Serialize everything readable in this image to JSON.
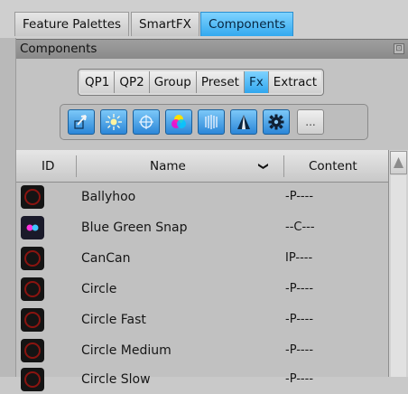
{
  "tabs": [
    {
      "label": "Feature Palettes",
      "active": false
    },
    {
      "label": "SmartFX",
      "active": false
    },
    {
      "label": "Components",
      "active": true
    }
  ],
  "panel": {
    "title": "Components",
    "collapse_glyph": "⊡"
  },
  "segments": [
    {
      "label": "QP1",
      "active": false
    },
    {
      "label": "QP2",
      "active": false
    },
    {
      "label": "Group",
      "active": false
    },
    {
      "label": "Preset",
      "active": false
    },
    {
      "label": "Fx",
      "active": true
    },
    {
      "label": "Extract",
      "active": false
    }
  ],
  "tools": [
    {
      "icon": "cursor-arrow-icon"
    },
    {
      "icon": "sparkle-light-icon"
    },
    {
      "icon": "crosshair-target-icon"
    },
    {
      "icon": "color-circles-icon"
    },
    {
      "icon": "vertical-lines-icon"
    },
    {
      "icon": "triangle-cone-icon"
    },
    {
      "icon": "gear-icon"
    },
    {
      "icon": "ellipsis-icon",
      "label": "..."
    }
  ],
  "table": {
    "columns": {
      "id": "ID",
      "name": "Name",
      "content": "Content",
      "sort_glyph": "❯"
    },
    "rows": [
      {
        "name": "Ballyhoo",
        "content": "-P----",
        "icon": "red-ring-icon"
      },
      {
        "name": "Blue Green Snap",
        "content": "--C---",
        "icon": "dual-dot-icon"
      },
      {
        "name": "CanCan",
        "content": "IP----",
        "icon": "red-ring-icon"
      },
      {
        "name": "Circle",
        "content": "-P----",
        "icon": "red-ring-icon"
      },
      {
        "name": "Circle Fast",
        "content": "-P----",
        "icon": "red-ring-icon"
      },
      {
        "name": "Circle Medium",
        "content": "-P----",
        "icon": "red-ring-icon"
      },
      {
        "name": "Circle Slow",
        "content": "-P----",
        "icon": "red-ring-icon"
      }
    ]
  },
  "colors": {
    "accent": "#33a9ef",
    "ring": "#8a1410"
  }
}
